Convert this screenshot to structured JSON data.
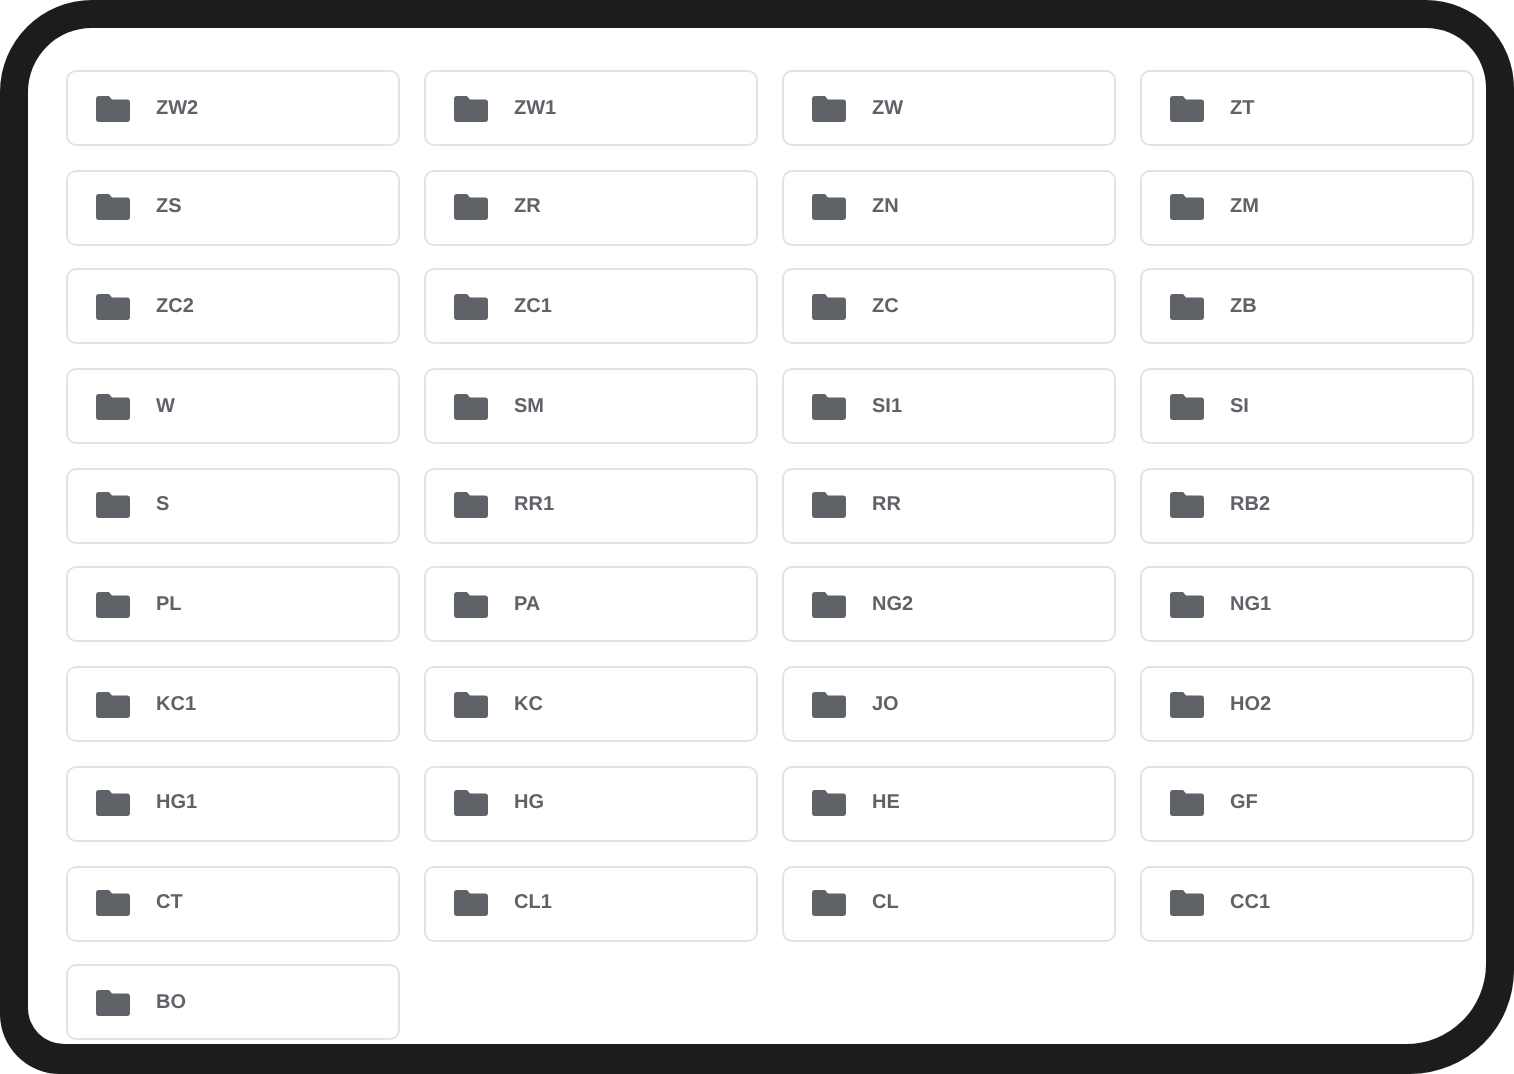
{
  "folders": [
    {
      "name": "ZW2"
    },
    {
      "name": "ZW1"
    },
    {
      "name": "ZW"
    },
    {
      "name": "ZT"
    },
    {
      "name": "ZS"
    },
    {
      "name": "ZR"
    },
    {
      "name": "ZN"
    },
    {
      "name": "ZM"
    },
    {
      "name": "ZC2"
    },
    {
      "name": "ZC1"
    },
    {
      "name": "ZC"
    },
    {
      "name": "ZB"
    },
    {
      "name": "W"
    },
    {
      "name": "SM"
    },
    {
      "name": "SI1"
    },
    {
      "name": "SI"
    },
    {
      "name": "S"
    },
    {
      "name": "RR1"
    },
    {
      "name": "RR"
    },
    {
      "name": "RB2"
    },
    {
      "name": "PL"
    },
    {
      "name": "PA"
    },
    {
      "name": "NG2"
    },
    {
      "name": "NG1"
    },
    {
      "name": "KC1"
    },
    {
      "name": "KC"
    },
    {
      "name": "JO"
    },
    {
      "name": "HO2"
    },
    {
      "name": "HG1"
    },
    {
      "name": "HG"
    },
    {
      "name": "HE"
    },
    {
      "name": "GF"
    },
    {
      "name": "CT"
    },
    {
      "name": "CL1"
    },
    {
      "name": "CL"
    },
    {
      "name": "CC1"
    },
    {
      "name": "BO"
    }
  ]
}
